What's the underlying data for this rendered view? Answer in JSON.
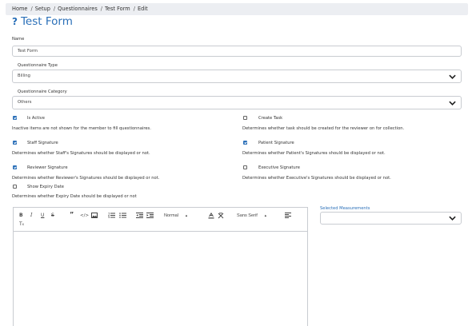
{
  "breadcrumb": {
    "items": [
      "Home",
      "Setup",
      "Questionnaires",
      "Test Form",
      "Edit"
    ]
  },
  "page": {
    "title": "Test Form",
    "help_icon": "question-mark-icon",
    "accent": "#2a6fb8"
  },
  "form": {
    "name": {
      "label": "Name",
      "value": "Test Form"
    },
    "questionnaire_type": {
      "label": "Questionnaire Type",
      "value": "Billing"
    },
    "questionnaire_category": {
      "label": "Questionnaire Category",
      "value": "Others"
    },
    "options": {
      "is_active": {
        "label": "Is Active",
        "checked": true,
        "description": "Inactive items are not shown for the member to fill questionnaires."
      },
      "create_task": {
        "label": "Create Task",
        "checked": false,
        "description": "Determines whether task should be created for the reviewer on for collection."
      },
      "staff_signature": {
        "label": "Staff Signature",
        "checked": true,
        "description": "Determines whether Staff's Signatures should be displayed or not."
      },
      "patient_signature": {
        "label": "Patient Signature",
        "checked": true,
        "description": "Determines whether Patient's Signatures should be displayed or not."
      },
      "reviewer_signature": {
        "label": "Reviewer Signature",
        "checked": true,
        "description": "Determines whether Reviewer's Signatures should be displayed or not."
      },
      "executive_signature": {
        "label": "Executive Signature",
        "checked": false,
        "description": "Determines whether Executive's Signatures should be displayed or not."
      },
      "show_expiry_date": {
        "label": "Show Expiry Date",
        "checked": false,
        "description": "Determines whether Expiry Date should be displayed or not"
      }
    },
    "selected_measurements": {
      "label": "Selected Measurements",
      "value": ""
    }
  },
  "editor": {
    "toolbar": {
      "buttons": [
        "bold-icon",
        "italic-icon",
        "underline-icon",
        "strikethrough-icon",
        "blockquote-icon",
        "code-icon",
        "image-icon",
        "ordered-list-icon",
        "bullet-list-icon",
        "indent-decrease-icon",
        "indent-increase-icon",
        "font-color-icon",
        "clean-format-icon",
        "align-icon",
        "clear-format-icon"
      ],
      "size_value": "Normal",
      "font_value": "Sans Serif"
    },
    "content": ""
  }
}
